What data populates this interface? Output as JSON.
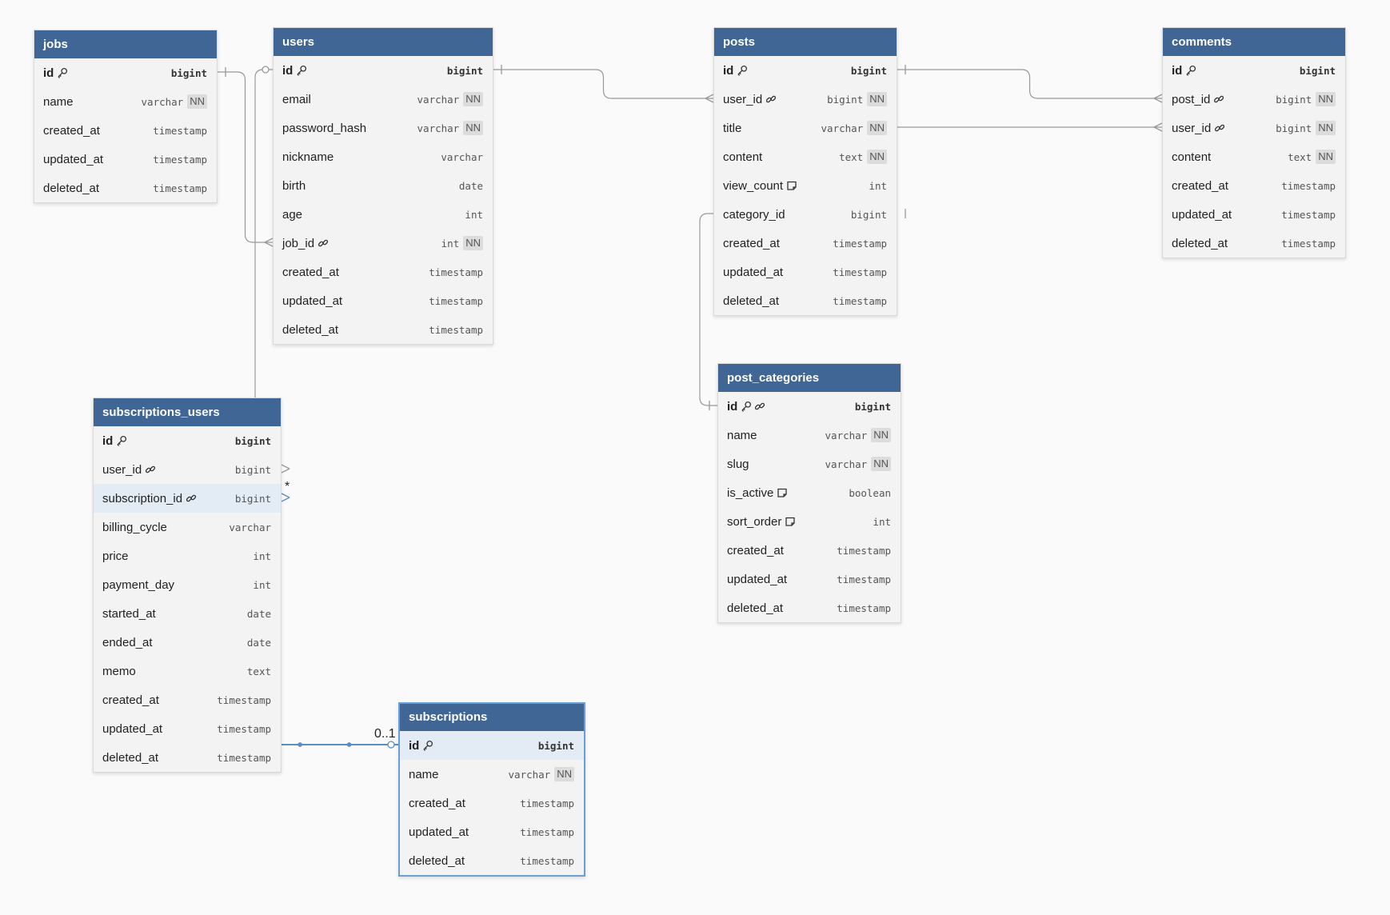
{
  "colors": {
    "header": "#3f6694",
    "body": "#f3f3f3",
    "highlight_row": "#e3ebf4",
    "relation": "#999999",
    "relation_active": "#5b8ec4",
    "badge_bg": "#dcdcdc"
  },
  "tables": [
    {
      "id": "jobs",
      "name": "jobs",
      "columns": [
        {
          "name": "id",
          "icons": [
            "key-icon"
          ],
          "type": "bigint",
          "nn": "",
          "pk": true
        },
        {
          "name": "name",
          "icons": [],
          "type": "varchar",
          "nn": "NN"
        },
        {
          "name": "created_at",
          "icons": [],
          "type": "timestamp",
          "nn": ""
        },
        {
          "name": "updated_at",
          "icons": [],
          "type": "timestamp",
          "nn": ""
        },
        {
          "name": "deleted_at",
          "icons": [],
          "type": "timestamp",
          "nn": ""
        }
      ]
    },
    {
      "id": "users",
      "name": "users",
      "columns": [
        {
          "name": "id",
          "icons": [
            "key-icon"
          ],
          "type": "bigint",
          "nn": "",
          "pk": true
        },
        {
          "name": "email",
          "icons": [],
          "type": "varchar",
          "nn": "NN"
        },
        {
          "name": "password_hash",
          "icons": [],
          "type": "varchar",
          "nn": "NN"
        },
        {
          "name": "nickname",
          "icons": [],
          "type": "varchar",
          "nn": ""
        },
        {
          "name": "birth",
          "icons": [],
          "type": "date",
          "nn": ""
        },
        {
          "name": "age",
          "icons": [],
          "type": "int",
          "nn": ""
        },
        {
          "name": "job_id",
          "icons": [
            "link-icon"
          ],
          "type": "int",
          "nn": "NN"
        },
        {
          "name": "created_at",
          "icons": [],
          "type": "timestamp",
          "nn": ""
        },
        {
          "name": "updated_at",
          "icons": [],
          "type": "timestamp",
          "nn": ""
        },
        {
          "name": "deleted_at",
          "icons": [],
          "type": "timestamp",
          "nn": ""
        }
      ]
    },
    {
      "id": "posts",
      "name": "posts",
      "columns": [
        {
          "name": "id",
          "icons": [
            "key-icon"
          ],
          "type": "bigint",
          "nn": "",
          "pk": true
        },
        {
          "name": "user_id",
          "icons": [
            "link-icon"
          ],
          "type": "bigint",
          "nn": "NN"
        },
        {
          "name": "title",
          "icons": [],
          "type": "varchar",
          "nn": "NN"
        },
        {
          "name": "content",
          "icons": [],
          "type": "text",
          "nn": "NN"
        },
        {
          "name": "view_count",
          "icons": [
            "note-icon"
          ],
          "type": "int",
          "nn": ""
        },
        {
          "name": "category_id",
          "icons": [],
          "type": "bigint",
          "nn": ""
        },
        {
          "name": "created_at",
          "icons": [],
          "type": "timestamp",
          "nn": ""
        },
        {
          "name": "updated_at",
          "icons": [],
          "type": "timestamp",
          "nn": ""
        },
        {
          "name": "deleted_at",
          "icons": [],
          "type": "timestamp",
          "nn": ""
        }
      ]
    },
    {
      "id": "comments",
      "name": "comments",
      "columns": [
        {
          "name": "id",
          "icons": [
            "key-icon"
          ],
          "type": "bigint",
          "nn": "",
          "pk": true
        },
        {
          "name": "post_id",
          "icons": [
            "link-icon"
          ],
          "type": "bigint",
          "nn": "NN"
        },
        {
          "name": "user_id",
          "icons": [
            "link-icon"
          ],
          "type": "bigint",
          "nn": "NN"
        },
        {
          "name": "content",
          "icons": [],
          "type": "text",
          "nn": "NN"
        },
        {
          "name": "created_at",
          "icons": [],
          "type": "timestamp",
          "nn": ""
        },
        {
          "name": "updated_at",
          "icons": [],
          "type": "timestamp",
          "nn": ""
        },
        {
          "name": "deleted_at",
          "icons": [],
          "type": "timestamp",
          "nn": ""
        }
      ]
    },
    {
      "id": "post_categories",
      "name": "post_categories",
      "columns": [
        {
          "name": "id",
          "icons": [
            "key-icon",
            "link-icon"
          ],
          "type": "bigint",
          "nn": "",
          "pk": true
        },
        {
          "name": "name",
          "icons": [],
          "type": "varchar",
          "nn": "NN"
        },
        {
          "name": "slug",
          "icons": [],
          "type": "varchar",
          "nn": "NN"
        },
        {
          "name": "is_active",
          "icons": [
            "note-icon"
          ],
          "type": "boolean",
          "nn": ""
        },
        {
          "name": "sort_order",
          "icons": [
            "note-icon"
          ],
          "type": "int",
          "nn": ""
        },
        {
          "name": "created_at",
          "icons": [],
          "type": "timestamp",
          "nn": ""
        },
        {
          "name": "updated_at",
          "icons": [],
          "type": "timestamp",
          "nn": ""
        },
        {
          "name": "deleted_at",
          "icons": [],
          "type": "timestamp",
          "nn": ""
        }
      ]
    },
    {
      "id": "subscriptions_users",
      "name": "subscriptions_users",
      "columns": [
        {
          "name": "id",
          "icons": [
            "key-icon"
          ],
          "type": "bigint",
          "nn": "",
          "pk": true
        },
        {
          "name": "user_id",
          "icons": [
            "link-icon"
          ],
          "type": "bigint",
          "nn": ""
        },
        {
          "name": "subscription_id",
          "icons": [
            "link-icon"
          ],
          "type": "bigint",
          "nn": "",
          "highlight": true
        },
        {
          "name": "billing_cycle",
          "icons": [],
          "type": "varchar",
          "nn": ""
        },
        {
          "name": "price",
          "icons": [],
          "type": "int",
          "nn": ""
        },
        {
          "name": "payment_day",
          "icons": [],
          "type": "int",
          "nn": ""
        },
        {
          "name": "started_at",
          "icons": [],
          "type": "date",
          "nn": ""
        },
        {
          "name": "ended_at",
          "icons": [],
          "type": "date",
          "nn": ""
        },
        {
          "name": "memo",
          "icons": [],
          "type": "text",
          "nn": ""
        },
        {
          "name": "created_at",
          "icons": [],
          "type": "timestamp",
          "nn": ""
        },
        {
          "name": "updated_at",
          "icons": [],
          "type": "timestamp",
          "nn": ""
        },
        {
          "name": "deleted_at",
          "icons": [],
          "type": "timestamp",
          "nn": ""
        }
      ]
    },
    {
      "id": "subscriptions",
      "name": "subscriptions",
      "selected": true,
      "columns": [
        {
          "name": "id",
          "icons": [
            "key-icon"
          ],
          "type": "bigint",
          "nn": "",
          "pk": true,
          "highlight": true
        },
        {
          "name": "name",
          "icons": [],
          "type": "varchar",
          "nn": "NN"
        },
        {
          "name": "created_at",
          "icons": [],
          "type": "timestamp",
          "nn": ""
        },
        {
          "name": "updated_at",
          "icons": [],
          "type": "timestamp",
          "nn": ""
        },
        {
          "name": "deleted_at",
          "icons": [],
          "type": "timestamp",
          "nn": ""
        }
      ]
    }
  ],
  "relations": [
    {
      "id": "jobs-users",
      "from": "jobs.id",
      "to": "users.job_id",
      "from_card": "one",
      "to_card": "many"
    },
    {
      "id": "users-posts",
      "from": "users.id",
      "to": "posts.user_id",
      "from_card": "one",
      "to_card": "many"
    },
    {
      "id": "users-subscriptions_users",
      "from": "users.id",
      "to": "subscriptions_users.user_id",
      "from_card": "zero-or-one",
      "to_card": "many"
    },
    {
      "id": "posts-comments",
      "from": "posts.id",
      "to": "comments.post_id",
      "from_card": "one",
      "to_card": "many"
    },
    {
      "id": "posts-comments-user",
      "from": "posts.title",
      "to": "comments.user_id",
      "from_card": "none",
      "to_card": "many"
    },
    {
      "id": "post_categories-posts",
      "from": "post_categories.id",
      "to": "posts.category_id",
      "from_card": "one",
      "to_card": "one"
    },
    {
      "id": "subscriptions-subscriptions_users",
      "from": "subscriptions.id",
      "to": "subscriptions_users.subscription_id",
      "from_card": "zero-or-one",
      "to_card": "many",
      "active": true,
      "from_label": "0..1",
      "to_label": "*"
    }
  ]
}
